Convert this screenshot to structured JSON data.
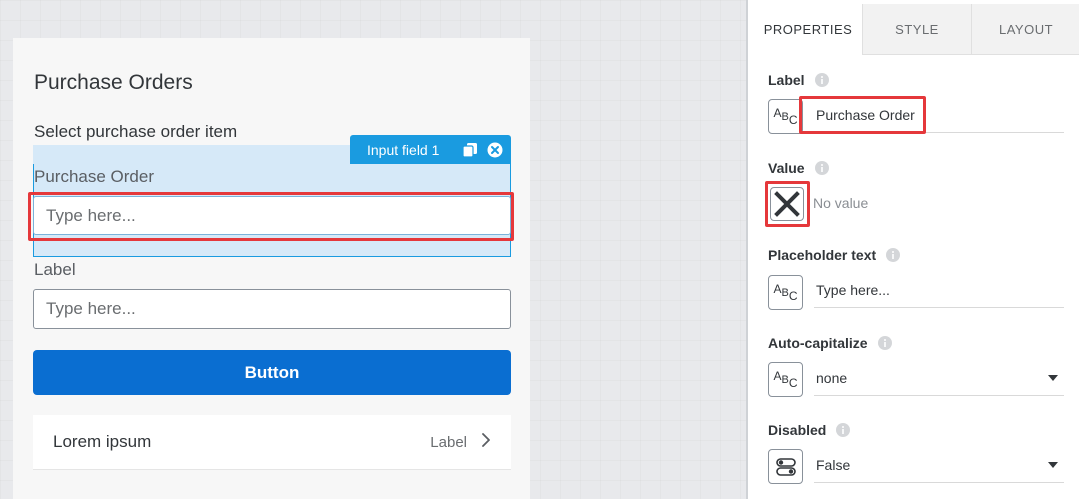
{
  "page": {
    "title": "Purchase Orders",
    "list_title": "Select purchase order item",
    "selection_toolbar": {
      "label": "Input field 1",
      "icons": [
        "copy-icon",
        "close-circle-icon"
      ]
    },
    "input1": {
      "label": "Purchase Order",
      "placeholder": "Type here..."
    },
    "input2": {
      "label": "Label",
      "placeholder": "Type here..."
    },
    "button": {
      "label": "Button"
    },
    "list_item": {
      "title": "Lorem ipsum",
      "info": "Label",
      "icon": "chevron-right-icon"
    }
  },
  "panel": {
    "tabs": [
      "PROPERTIES",
      "STYLE",
      "LAYOUT"
    ],
    "active_tab": "PROPERTIES",
    "props": {
      "label": {
        "name": "Label",
        "value": "Purchase Order"
      },
      "value": {
        "name": "Value",
        "value": "No value"
      },
      "placeholder": {
        "name": "Placeholder text",
        "value": "Type here..."
      },
      "autocap": {
        "name": "Auto-capitalize",
        "value": "none"
      },
      "disabled": {
        "name": "Disabled",
        "value": "False"
      }
    }
  },
  "colors": {
    "accent": "#0a6ed1",
    "selection": "#1a9be0",
    "highlight": "#e5383b"
  }
}
